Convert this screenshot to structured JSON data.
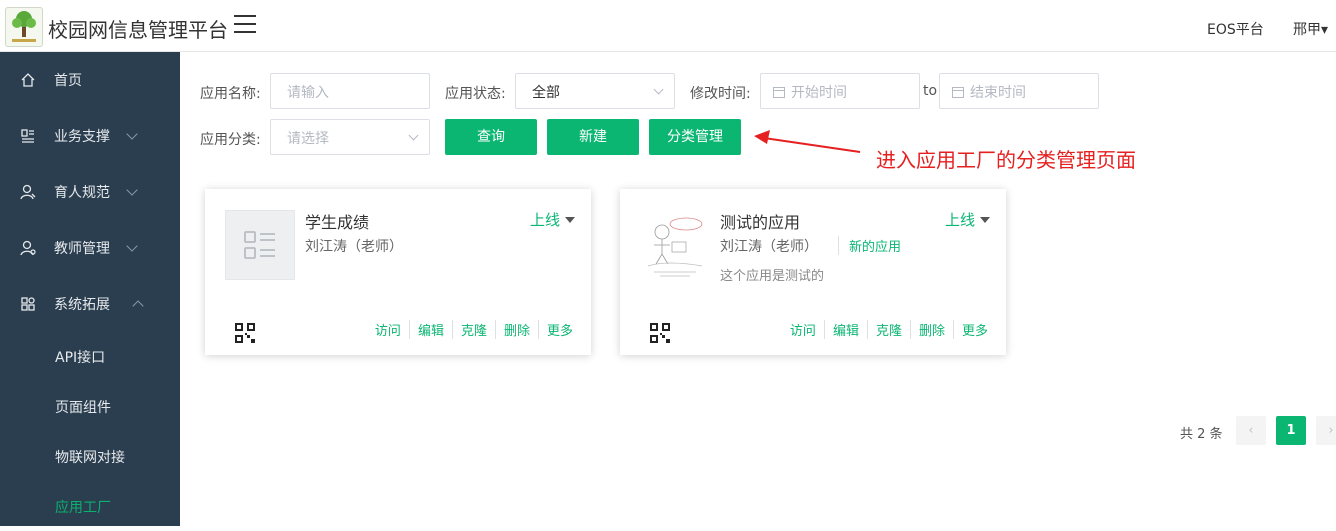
{
  "header": {
    "title": "校园网信息管理平台",
    "platform_link": "EOS平台",
    "user": "邢甲▾"
  },
  "sidebar": {
    "items": [
      {
        "label": "首页",
        "icon": "home-icon"
      },
      {
        "label": "业务支撑",
        "icon": "business-icon"
      },
      {
        "label": "育人规范",
        "icon": "person-icon"
      },
      {
        "label": "教师管理",
        "icon": "teacher-icon"
      },
      {
        "label": "系统拓展",
        "icon": "extension-icon"
      }
    ],
    "subitems": [
      {
        "label": "API接口"
      },
      {
        "label": "页面组件"
      },
      {
        "label": "物联网对接"
      },
      {
        "label": "应用工厂"
      }
    ]
  },
  "filters": {
    "name_label": "应用名称:",
    "name_placeholder": "请输入",
    "status_label": "应用状态:",
    "status_value": "全部",
    "time_label": "修改时间:",
    "start_placeholder": "开始时间",
    "to": "to",
    "end_placeholder": "结束时间",
    "category_label": "应用分类:",
    "category_placeholder": "请选择"
  },
  "buttons": {
    "query": "查询",
    "create": "新建",
    "category_manage": "分类管理"
  },
  "annotation": "进入应用工厂的分类管理页面",
  "cards": [
    {
      "title": "学生成绩",
      "author": "刘江涛（老师）",
      "status": "上线",
      "actions": [
        "访问",
        "编辑",
        "克隆",
        "删除",
        "更多"
      ]
    },
    {
      "title": "测试的应用",
      "author": "刘江涛（老师）",
      "tag": "新的应用",
      "desc": "这个应用是测试的",
      "status": "上线",
      "actions": [
        "访问",
        "编辑",
        "克隆",
        "删除",
        "更多"
      ]
    }
  ],
  "pagination": {
    "total": "共 2 条",
    "current": "1"
  },
  "colors": {
    "primary": "#0bb673",
    "sidebar_bg": "#2b3e4f",
    "annotation": "#e62020"
  }
}
